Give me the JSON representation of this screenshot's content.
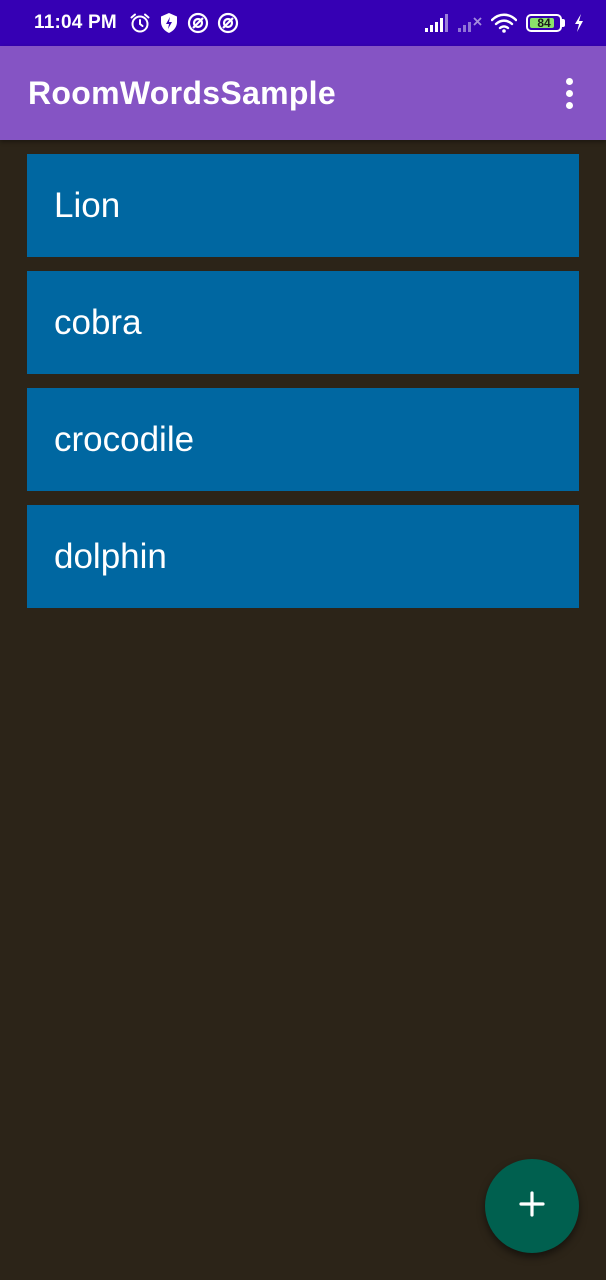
{
  "status_bar": {
    "time": "11:04 PM",
    "battery_level": "84",
    "battery_fraction": 0.84,
    "left_icons": [
      "alarm-icon",
      "vpn-shield-icon",
      "sync-circle-icon",
      "sync-circle-icon"
    ],
    "right_icons": [
      "signal-strong-icon",
      "signal-weak-no-service-icon",
      "wifi-icon",
      "battery-icon",
      "charging-bolt-icon"
    ]
  },
  "app_bar": {
    "title": "RoomWordsSample",
    "menu_icon": "more-vertical-icon"
  },
  "words": [
    {
      "label": "Lion"
    },
    {
      "label": "cobra"
    },
    {
      "label": "crocodile"
    },
    {
      "label": "dolphin"
    }
  ],
  "fab": {
    "icon": "add-icon"
  },
  "colors": {
    "status_bar": "#3600b4",
    "app_bar": "#8554c4",
    "background": "#2c2418",
    "word_item": "#0067a1",
    "fab": "#00604f",
    "battery_fill": "#8be36a"
  }
}
